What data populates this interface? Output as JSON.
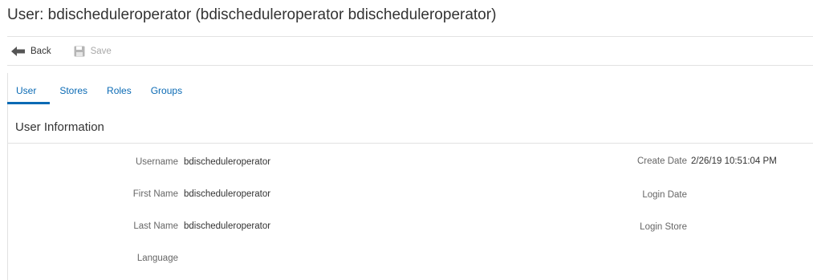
{
  "page": {
    "title": "User: bdischeduleroperator (bdischeduleroperator bdischeduleroperator)"
  },
  "toolbar": {
    "back_label": "Back",
    "back_icon": "arrow-left-icon",
    "save_label": "Save",
    "save_icon": "floppy-disk-icon",
    "save_enabled": false
  },
  "tabs": [
    {
      "label": "User",
      "active": true
    },
    {
      "label": "Stores",
      "active": false
    },
    {
      "label": "Roles",
      "active": false
    },
    {
      "label": "Groups",
      "active": false
    }
  ],
  "section": {
    "title": "User Information"
  },
  "fields_left": [
    {
      "label": "Username",
      "value": "bdischeduleroperator"
    },
    {
      "label": "First Name",
      "value": "bdischeduleroperator"
    },
    {
      "label": "Last Name",
      "value": "bdischeduleroperator"
    },
    {
      "label": "Language",
      "value": ""
    }
  ],
  "fields_right": [
    {
      "label": "Create Date",
      "value": "2/26/19 10:51:04 PM"
    },
    {
      "label": "Login Date",
      "value": ""
    },
    {
      "label": "Login Store",
      "value": ""
    }
  ],
  "colors": {
    "accent": "#0a6ab4",
    "text": "#333333",
    "label": "#666666",
    "disabled": "#a9a9a9",
    "divider": "#e2e2e2"
  }
}
